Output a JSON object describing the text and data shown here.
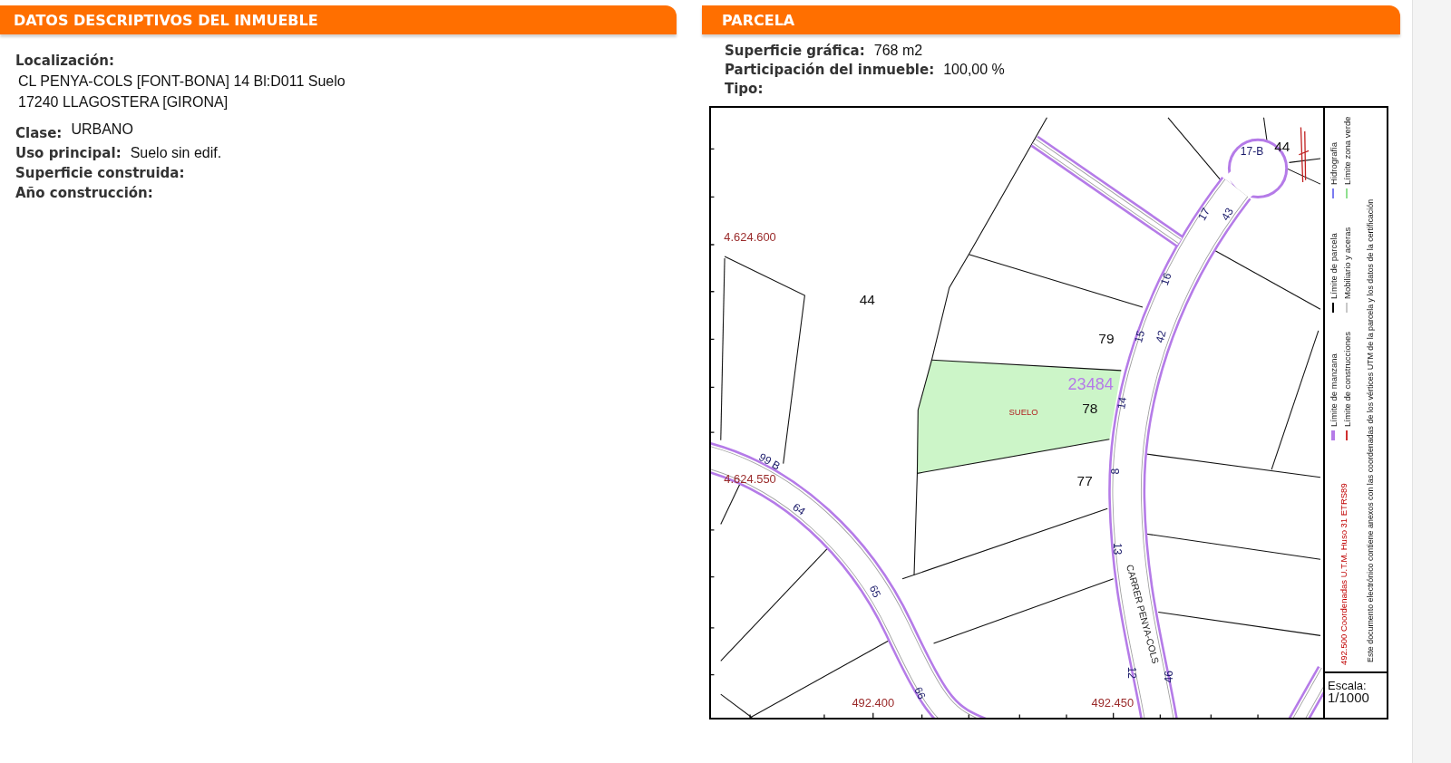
{
  "descriptive_panel": {
    "title": "DATOS DESCRIPTIVOS DEL INMUEBLE",
    "location": {
      "label": "Localización:",
      "lines": [
        "CL PENYA-COLS [FONT-BONA] 14 Bl:D011 Suelo",
        "17240 LLAGOSTERA [GIRONA]"
      ]
    },
    "fields": [
      {
        "label": "Clase:",
        "value": "URBANO"
      },
      {
        "label": "Uso principal:",
        "value": "Suelo sin edif."
      },
      {
        "label": "Superficie construida:"
      },
      {
        "label": "Año construcción:"
      }
    ]
  },
  "parcel_panel": {
    "title": "PARCELA",
    "fields": [
      {
        "label": "Superficie gráfica:",
        "value": "768 m2"
      },
      {
        "label": "Participación del inmueble:",
        "value": "100,00 %"
      },
      {
        "label": "Tipo:"
      }
    ],
    "map": {
      "labels": [
        {
          "text": "4.624.600",
          "kind": "coordinate"
        },
        {
          "text": "44",
          "kind": "parcel_number"
        },
        {
          "text": "17-B",
          "kind": "house_number"
        },
        {
          "text": "44",
          "kind": "parcel_number"
        },
        {
          "text": "17",
          "kind": "house_number"
        },
        {
          "text": "43",
          "kind": "house_number"
        },
        {
          "text": "16",
          "kind": "house_number"
        },
        {
          "text": "79",
          "kind": "parcel_number"
        },
        {
          "text": "15",
          "kind": "house_number"
        },
        {
          "text": "42",
          "kind": "house_number"
        },
        {
          "text": "23484",
          "kind": "block_id"
        },
        {
          "text": "SUELO",
          "kind": "land_use"
        },
        {
          "text": "78",
          "kind": "parcel_number"
        },
        {
          "text": "14",
          "kind": "house_number"
        },
        {
          "text": "4.624.550",
          "kind": "coordinate"
        },
        {
          "text": "99 B",
          "kind": "house_number"
        },
        {
          "text": "77",
          "kind": "parcel_number"
        },
        {
          "text": "8",
          "kind": "house_number"
        },
        {
          "text": "64",
          "kind": "house_number"
        },
        {
          "text": "13",
          "kind": "house_number"
        },
        {
          "text": "CARRER PENYA-COLS",
          "kind": "street"
        },
        {
          "text": "65",
          "kind": "house_number"
        },
        {
          "text": "12",
          "kind": "house_number"
        },
        {
          "text": "46",
          "kind": "house_number"
        },
        {
          "text": "66",
          "kind": "house_number"
        },
        {
          "text": "492.400",
          "kind": "coordinate"
        },
        {
          "text": "492.450",
          "kind": "coordinate"
        }
      ],
      "legend": {
        "items": [
          {
            "label": "Límite de manzana",
            "color": "#b57be8"
          },
          {
            "label": "Límite de parcela",
            "color": "#000000"
          },
          {
            "label": "Hidrografía",
            "color": "#7b7bf0"
          },
          {
            "label": "Límite de construcciones",
            "color": "#d03030"
          },
          {
            "label": "Mobiliario y aceras",
            "color": "#c8c8c8"
          },
          {
            "label": "Límite zona verde",
            "color": "#90e090"
          }
        ],
        "coordinates_note": "492.500 Coordenadas U.T.M. Huso 31 ETRS89",
        "certification_note": "Este documento electrónico contiene anexos con las coordenadas de los vértices UTM de la parcela y los datos de la certificación"
      },
      "scale": {
        "label": "Escala:",
        "value": "1/1000"
      }
    }
  }
}
